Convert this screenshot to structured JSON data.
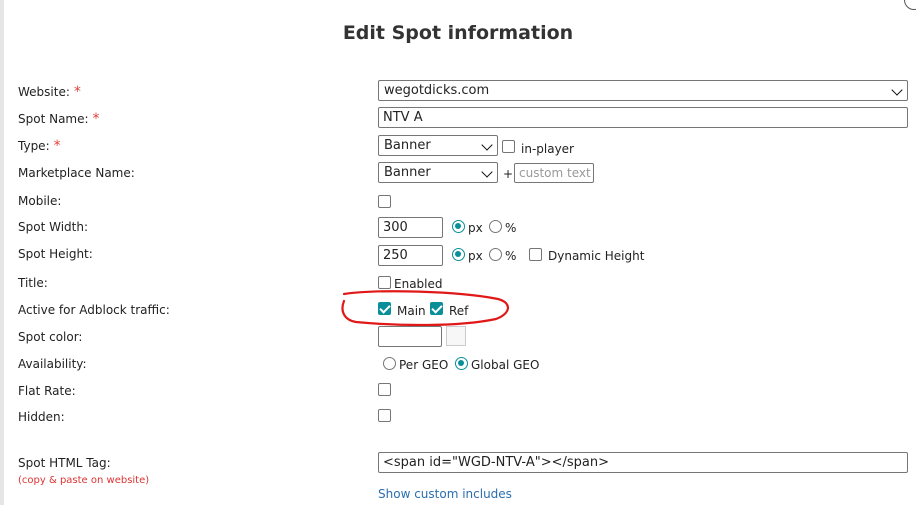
{
  "dialog": {
    "title": "Edit Spot information"
  },
  "labels": {
    "website": "Website:",
    "spot_name": "Spot Name:",
    "type": "Type:",
    "marketplace_name": "Marketplace Name:",
    "mobile": "Mobile:",
    "spot_width": "Spot Width:",
    "spot_height": "Spot Height:",
    "title": "Title:",
    "active_adblock": "Active for Adblock traffic:",
    "spot_color": "Spot color:",
    "availability": "Availability:",
    "flat_rate": "Flat Rate:",
    "hidden": "Hidden:",
    "spot_html_tag": "Spot HTML Tag:",
    "copy_note": "(copy & paste on website)",
    "required_mark": "*"
  },
  "fields": {
    "website_value": "wegotdicks.com",
    "spot_name_value": "NTV A",
    "type_value": "Banner",
    "in_player_label": "in-player",
    "marketplace_value": "Banner",
    "plus": "+",
    "custom_text_placeholder": "custom text",
    "width_value": "300",
    "height_value": "250",
    "px_label": "px",
    "percent_label": "%",
    "dynamic_height_label": "Dynamic Height",
    "title_enabled_label": "Enabled",
    "adblock_main_label": "Main",
    "adblock_ref_label": "Ref",
    "per_geo_label": "Per GEO",
    "global_geo_label": "Global GEO",
    "html_tag_value": "<span id=\"WGD-NTV-A\"></span>",
    "show_custom_includes": "Show custom includes"
  },
  "state": {
    "mobile_checked": false,
    "in_player_checked": false,
    "width_unit": "px",
    "height_unit": "px",
    "dynamic_height_checked": false,
    "title_enabled_checked": false,
    "adblock_main_checked": true,
    "adblock_ref_checked": true,
    "availability": "Global GEO",
    "flat_rate_checked": false,
    "hidden_checked": false
  },
  "colors": {
    "accent": "#0a8f9a",
    "required": "#e0403c",
    "annotation": "#e01818",
    "link": "#2a6fb0"
  }
}
